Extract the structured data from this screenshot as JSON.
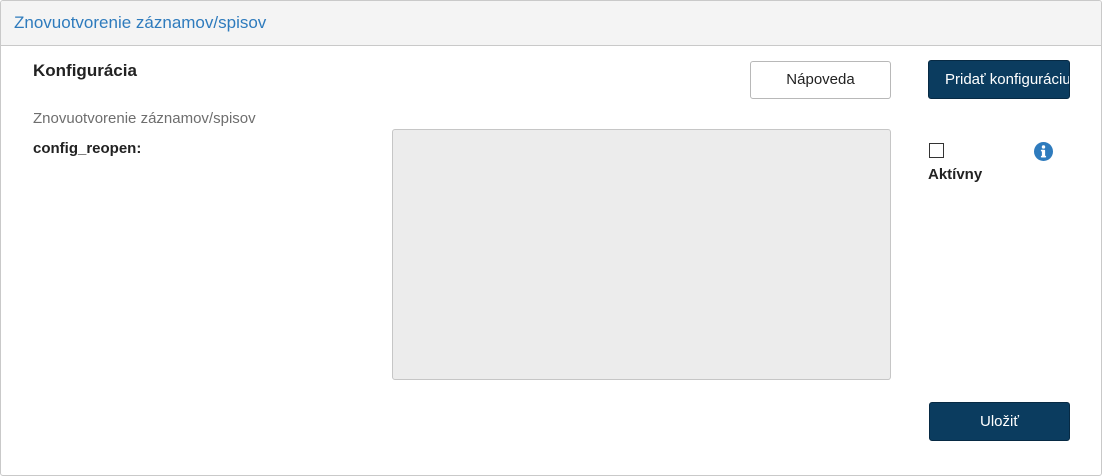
{
  "panel": {
    "title": "Znovuotvorenie záznamov/spisov"
  },
  "section": {
    "title": "Konfigurácia"
  },
  "buttons": {
    "help_label": "Nápoveda",
    "add_config_label": "Pridať konfiguráciu",
    "save_label": "Uložiť"
  },
  "config": {
    "description": "Znovuotvorenie záznamov/spisov",
    "field_label": "config_reopen:",
    "field_value": "",
    "active_label": "Aktívny",
    "active_checked": false
  },
  "icons": {
    "info": "info-icon"
  },
  "colors": {
    "title_blue": "#2e7bbd",
    "primary_button": "#0b3c5f",
    "info_icon": "#2e7bbd",
    "textarea_bg": "#ececec"
  }
}
